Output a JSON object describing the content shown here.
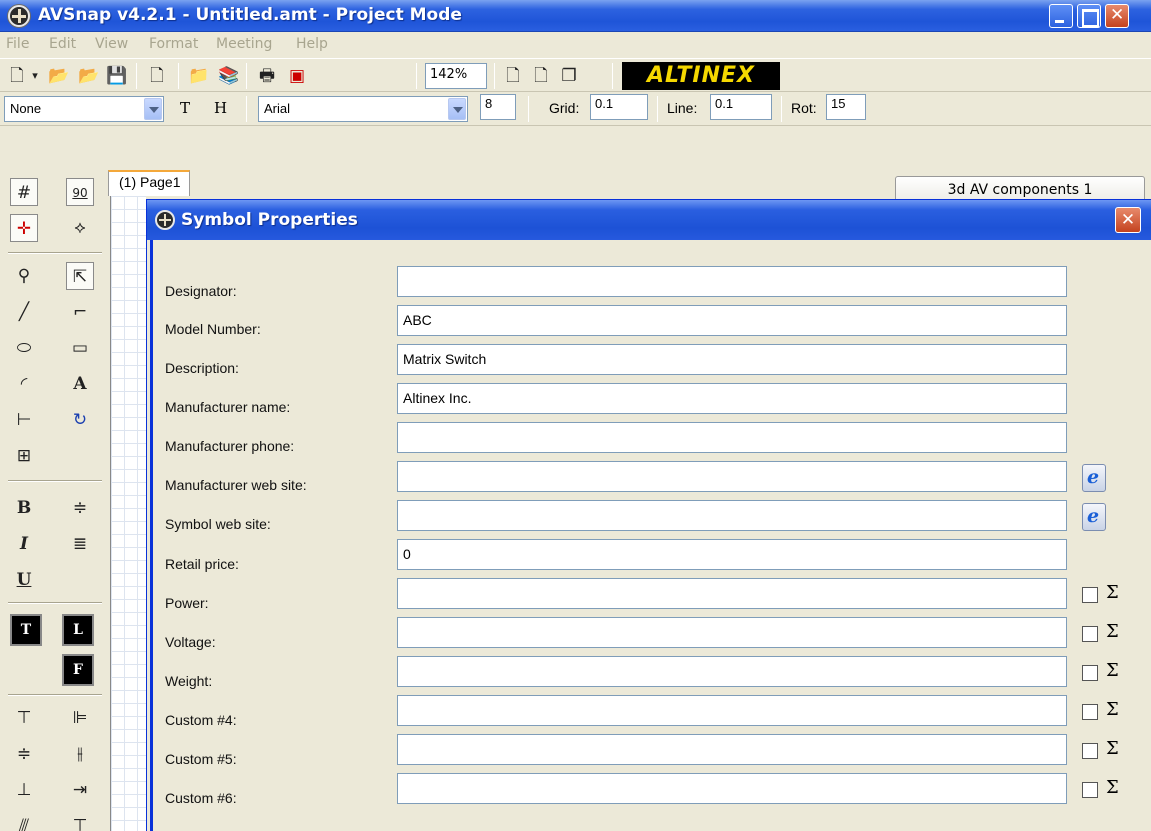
{
  "window": {
    "title": "AVSnap v4.2.1 - Untitled.amt  - Project Mode"
  },
  "menu": [
    "File",
    "Edit",
    "View",
    "Format",
    "Meeting",
    "Help"
  ],
  "toolbar": {
    "zoom": "142%",
    "logo_text": "ALTINEX"
  },
  "format_bar": {
    "style_value": "None",
    "t_label": "T",
    "h_label": "H",
    "font_value": "Arial",
    "size_value": "8",
    "grid_label": "Grid:",
    "grid_value": "0.1",
    "line_label": "Line:",
    "line_value": "0.1",
    "rot_label": "Rot:",
    "rot_value": "15"
  },
  "palette": {
    "angle_label": "90",
    "text_t": "T",
    "text_l": "L",
    "text_f": "F"
  },
  "page_tab": "(1) Page1",
  "components_tab": "3d AV components 1",
  "dialog": {
    "title": "Symbol Properties",
    "fields": [
      {
        "label": "Designator:",
        "value": ""
      },
      {
        "label": "Model Number:",
        "value": "ABC"
      },
      {
        "label": "Description:",
        "value": "Matrix Switch"
      },
      {
        "label": "Manufacturer name:",
        "value": "Altinex Inc."
      },
      {
        "label": "Manufacturer phone:",
        "value": ""
      },
      {
        "label": "Manufacturer web site:",
        "value": ""
      },
      {
        "label": "Symbol web site:",
        "value": ""
      },
      {
        "label": "Retail price:",
        "value": "0"
      },
      {
        "label": "Power:",
        "value": ""
      },
      {
        "label": "Voltage:",
        "value": ""
      },
      {
        "label": "Weight:",
        "value": ""
      },
      {
        "label": "Custom #4:",
        "value": ""
      },
      {
        "label": "Custom #5:",
        "value": ""
      },
      {
        "label": "Custom #6:",
        "value": ""
      }
    ],
    "sum_symbol": "Σ"
  }
}
